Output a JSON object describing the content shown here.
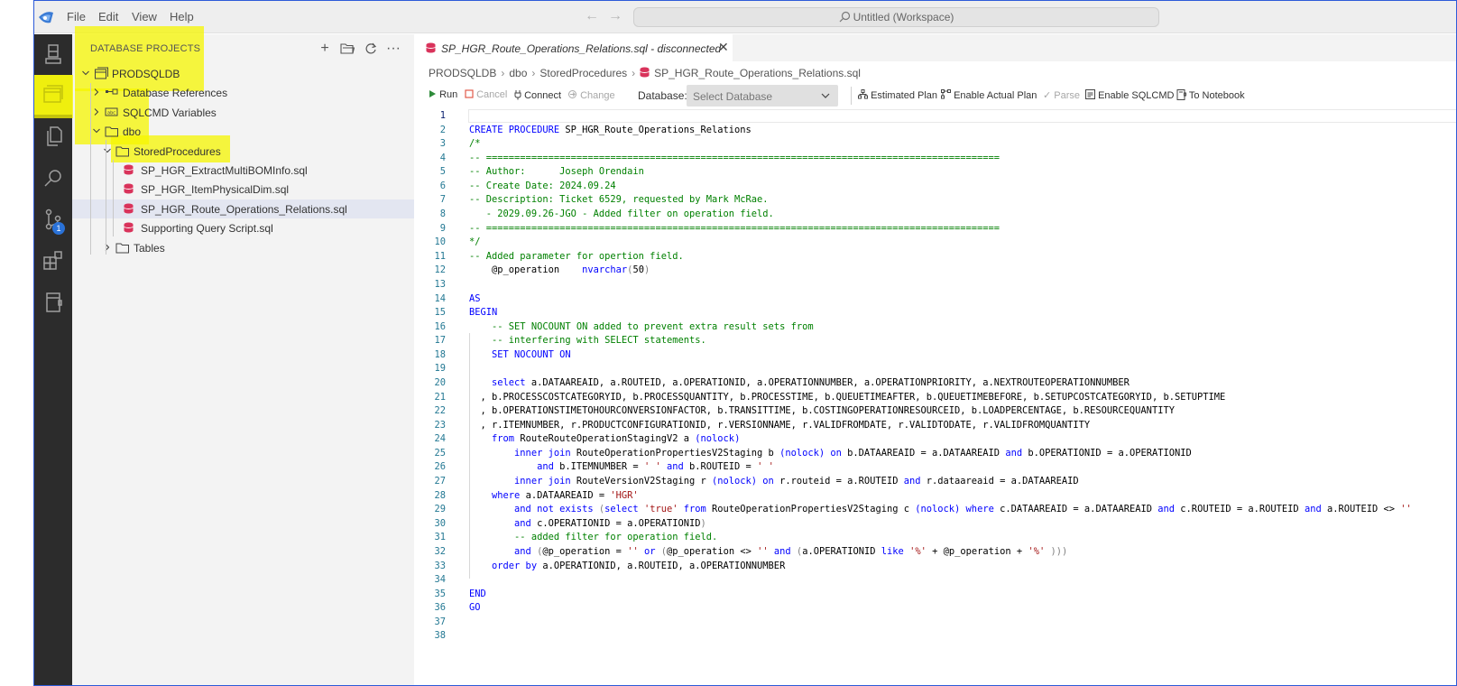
{
  "menu": [
    "File",
    "Edit",
    "View",
    "Help"
  ],
  "command_center": "Untitled (Workspace)",
  "scm_badge": "1",
  "sidebar": {
    "title": "DATABASE PROJECTS",
    "tree": [
      {
        "label": "PRODSQLDB",
        "depth": 0,
        "chevron": "down",
        "icon": "project-icon"
      },
      {
        "label": "Database References",
        "depth": 1,
        "chevron": "right",
        "icon": "references-icon"
      },
      {
        "label": "SQLCMD Variables",
        "depth": 1,
        "chevron": "right",
        "icon": "variables-icon"
      },
      {
        "label": "dbo",
        "depth": 1,
        "chevron": "down",
        "icon": "folder-icon"
      },
      {
        "label": "StoredProcedures",
        "depth": 2,
        "chevron": "down",
        "icon": "folder-icon"
      },
      {
        "label": "SP_HGR_ExtractMultiBOMInfo.sql",
        "depth": 3,
        "chevron": "none",
        "icon": "sql-file-icon"
      },
      {
        "label": "SP_HGR_ItemPhysicalDim.sql",
        "depth": 3,
        "chevron": "none",
        "icon": "sql-file-icon"
      },
      {
        "label": "SP_HGR_Route_Operations_Relations.sql",
        "depth": 3,
        "chevron": "none",
        "icon": "sql-file-icon",
        "selected": true
      },
      {
        "label": "Supporting Query Script.sql",
        "depth": 3,
        "chevron": "none",
        "icon": "sql-file-icon"
      },
      {
        "label": "Tables",
        "depth": 2,
        "chevron": "right",
        "icon": "folder-icon"
      }
    ]
  },
  "editor": {
    "tab_label": "SP_HGR_Route_Operations_Relations.sql - disconnected",
    "breadcrumb": [
      "PRODSQLDB",
      "dbo",
      "StoredProcedures",
      "SP_HGR_Route_Operations_Relations.sql"
    ],
    "toolbar": {
      "run": "Run",
      "cancel": "Cancel",
      "connect": "Connect",
      "change": "Change",
      "database_label": "Database:",
      "database_value": "Select Database",
      "estimated_plan": "Estimated Plan",
      "actual_plan": "Enable Actual Plan",
      "parse": "Parse",
      "sqlcmd": "Enable SQLCMD",
      "notebook": "To Notebook"
    },
    "current_line": 1,
    "code": [
      [],
      [
        [
          "k",
          "CREATE PROCEDURE "
        ],
        [
          "",
          "SP_HGR_Route_Operations_Relations"
        ]
      ],
      [
        [
          "c",
          "/*"
        ]
      ],
      [
        [
          "c",
          "-- ==========================================================================================="
        ]
      ],
      [
        [
          "c",
          "-- Author:      Joseph Orendain"
        ]
      ],
      [
        [
          "c",
          "-- Create Date: 2024.09.24"
        ]
      ],
      [
        [
          "c",
          "-- Description: Ticket 6529, requested by Mark McRae."
        ]
      ],
      [
        [
          "c",
          "   - 2029.09.26-JGO - Added filter on operation field."
        ]
      ],
      [
        [
          "c",
          "-- ==========================================================================================="
        ]
      ],
      [
        [
          "c",
          "*/"
        ]
      ],
      [
        [
          "c",
          "-- Added parameter for opertion field."
        ]
      ],
      [
        [
          "",
          "    @p_operation    "
        ],
        [
          "k",
          "nvarchar"
        ],
        [
          "g",
          "("
        ],
        [
          "",
          "50"
        ],
        [
          "g",
          ")"
        ]
      ],
      [],
      [
        [
          "k",
          "AS"
        ]
      ],
      [
        [
          "k",
          "BEGIN"
        ]
      ],
      [
        [
          "c",
          "    -- SET NOCOUNT ON added to prevent extra result sets from"
        ]
      ],
      [
        [
          "c",
          "    -- interfering with SELECT statements."
        ]
      ],
      [
        [
          "k",
          "    SET NOCOUNT ON"
        ]
      ],
      [],
      [
        [
          "k",
          "    select "
        ],
        [
          "",
          "a.DATAAREAID, a.ROUTEID, a.OPERATIONID, a.OPERATIONNUMBER, a.OPERATIONPRIORITY, a.NEXTROUTEOPERATIONNUMBER"
        ]
      ],
      [
        [
          "",
          "  , b.PROCESSCOSTCATEGORYID, b.PROCESSQUANTITY, b.PROCESSTIME, b.QUEUETIMEAFTER, b.QUEUETIMEBEFORE, b.SETUPCOSTCATEGORYID, b.SETUPTIME"
        ]
      ],
      [
        [
          "",
          "  , b.OPERATIONSTIMETOHOURCONVERSIONFACTOR, b.TRANSITTIME, b.COSTINGOPERATIONRESOURCEID, b.LOADPERCENTAGE, b.RESOURCEQUANTITY"
        ]
      ],
      [
        [
          "",
          "  , r.ITEMNUMBER, r.PRODUCTCONFIGURATIONID, r.VERSIONNAME, r.VALIDFROMDATE, r.VALIDTODATE, r.VALIDFROMQUANTITY"
        ]
      ],
      [
        [
          "k",
          "    from "
        ],
        [
          "",
          "RouteRouteOperationStagingV2 a "
        ],
        [
          "k",
          "("
        ],
        [
          "k",
          "nolock"
        ],
        [
          "k",
          ")"
        ]
      ],
      [
        [
          "k",
          "        inner join "
        ],
        [
          "",
          "RouteOperationPropertiesV2Staging b "
        ],
        [
          "k",
          "(nolock) on "
        ],
        [
          "",
          "b.DATAAREAID = a.DATAAREAID "
        ],
        [
          "k",
          "and "
        ],
        [
          "",
          "b.OPERATIONID = a.OPERATIONID"
        ]
      ],
      [
        [
          "k",
          "            and "
        ],
        [
          "",
          "b.ITEMNUMBER = "
        ],
        [
          "s",
          "' '"
        ],
        [
          "k",
          " and "
        ],
        [
          "",
          "b.ROUTEID = "
        ],
        [
          "s",
          "' '"
        ]
      ],
      [
        [
          "k",
          "        inner join "
        ],
        [
          "",
          "RouteVersionV2Staging r "
        ],
        [
          "k",
          "(nolock) on "
        ],
        [
          "",
          "r.routeid = a.ROUTEID "
        ],
        [
          "k",
          "and "
        ],
        [
          "",
          "r.dataareaid = a.DATAAREAID"
        ]
      ],
      [
        [
          "k",
          "    where "
        ],
        [
          "",
          "a.DATAAREAID = "
        ],
        [
          "s",
          "'HGR'"
        ]
      ],
      [
        [
          "k",
          "        and not exists "
        ],
        [
          "g",
          "("
        ],
        [
          "k",
          "select "
        ],
        [
          "s",
          "'true' "
        ],
        [
          "k",
          "from "
        ],
        [
          "",
          "RouteOperationPropertiesV2Staging c "
        ],
        [
          "k",
          "(nolock) where "
        ],
        [
          "",
          "c.DATAAREAID = a.DATAAREAID "
        ],
        [
          "k",
          "and "
        ],
        [
          "",
          "c.ROUTEID = a.ROUTEID "
        ],
        [
          "k",
          "and "
        ],
        [
          "",
          "a.ROUTEID <> "
        ],
        [
          "s",
          "''"
        ]
      ],
      [
        [
          "k",
          "        and "
        ],
        [
          "",
          "c.OPERATIONID = a.OPERATIONID"
        ],
        [
          "g",
          ")"
        ]
      ],
      [
        [
          "c",
          "        -- added filter for operation field."
        ]
      ],
      [
        [
          "k",
          "        and "
        ],
        [
          "g",
          "("
        ],
        [
          "",
          "@p_operation = "
        ],
        [
          "s",
          "'' "
        ],
        [
          "k",
          "or "
        ],
        [
          "g",
          "("
        ],
        [
          "",
          "@p_operation <> "
        ],
        [
          "s",
          "'' "
        ],
        [
          "k",
          "and "
        ],
        [
          "g",
          "("
        ],
        [
          "",
          "a.OPERATIONID "
        ],
        [
          "k",
          "like "
        ],
        [
          "s",
          "'%' "
        ],
        [
          "",
          "+ @p_operation + "
        ],
        [
          "s",
          "'%' "
        ],
        [
          "g",
          ")))"
        ]
      ],
      [
        [
          "k",
          "    order by "
        ],
        [
          "",
          "a.OPERATIONID, a.ROUTEID, a.OPERATIONNUMBER"
        ]
      ],
      [],
      [
        [
          "k",
          "END"
        ]
      ],
      [
        [
          "k",
          "GO"
        ]
      ],
      [],
      []
    ]
  }
}
